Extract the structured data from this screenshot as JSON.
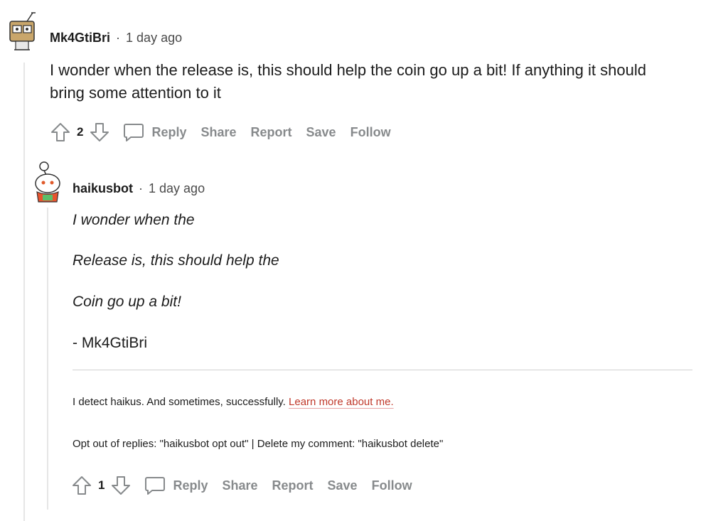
{
  "comment1": {
    "author": "Mk4GtiBri",
    "separator": "·",
    "time": "1 day ago",
    "body": "I wonder when the release is, this should help the coin go up a bit! If anything it should bring some attention to it",
    "score": "2",
    "actions": {
      "reply": "Reply",
      "share": "Share",
      "report": "Report",
      "save": "Save",
      "follow": "Follow"
    }
  },
  "comment2": {
    "author": "haikusbot",
    "separator": "·",
    "time": "1 day ago",
    "haiku": [
      "I wonder when the",
      "Release is, this should help the",
      "Coin go up a bit!"
    ],
    "signature": "- Mk4GtiBri",
    "footer_text": "I detect haikus. And sometimes, successfully.",
    "footer_link": "Learn more about me.",
    "optout_text": "Opt out of replies: \"haikusbot opt out\" | Delete my comment: \"haikusbot delete\"",
    "score": "1",
    "actions": {
      "reply": "Reply",
      "share": "Share",
      "report": "Report",
      "save": "Save",
      "follow": "Follow"
    }
  },
  "colors": {
    "link": "#c0392b",
    "muted": "#878a8c",
    "thread": "#e6e6e6"
  }
}
